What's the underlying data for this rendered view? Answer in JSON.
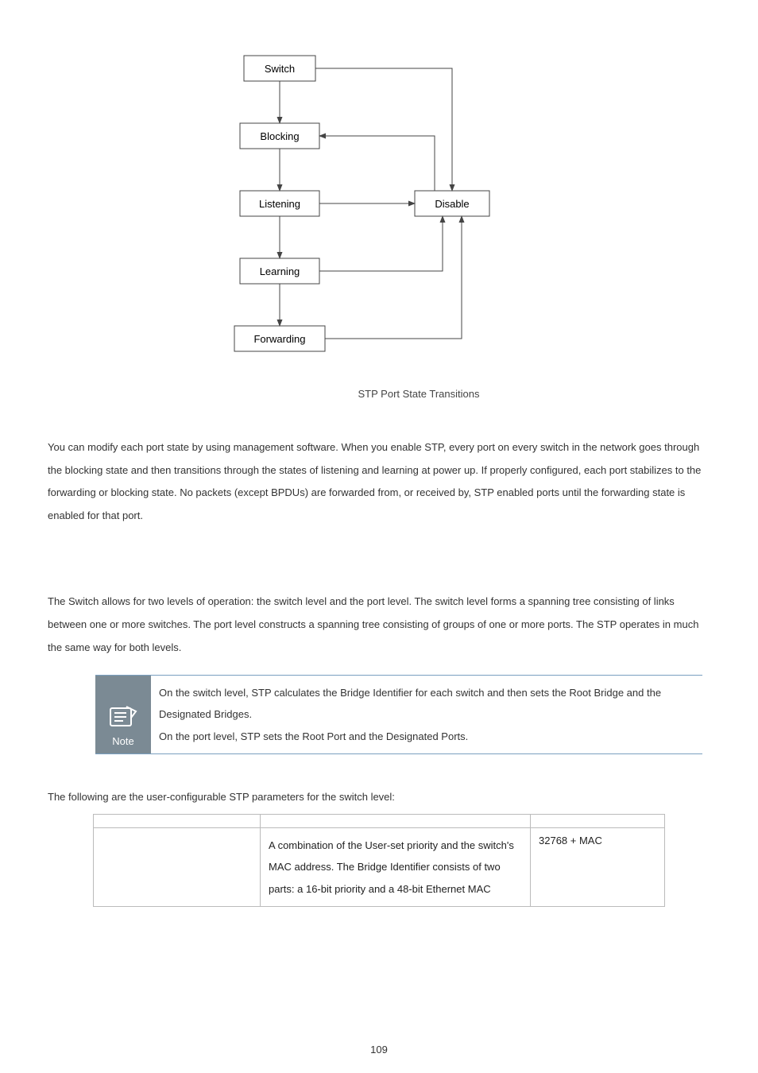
{
  "diagram": {
    "nodes": {
      "switch": "Switch",
      "blocking": "Blocking",
      "listening": "Listening",
      "learning": "Learning",
      "forwarding": "Forwarding",
      "disable": "Disable"
    },
    "caption": "STP Port State Transitions"
  },
  "paragraph1": "You can modify each port state by using management software. When you enable STP, every port on every switch in the network goes through the blocking state and then transitions through the states of listening and learning at power up. If properly configured, each port stabilizes to the forwarding or blocking state. No packets (except BPDUs) are forwarded from, or received by, STP enabled ports until the forwarding state is enabled for that port.",
  "paragraph2": "The Switch allows for two levels of operation: the switch level and the port level. The switch level forms a spanning tree consisting of links between one or more switches. The port level constructs a spanning tree consisting of groups of one or more ports. The STP operates in much the same way for both levels.",
  "note": {
    "badge": "Note",
    "line1": "On the switch level, STP calculates the Bridge Identifier for each switch and then sets the Root Bridge and the Designated Bridges.",
    "line2": "On the port level, STP sets the Root Port and the Designated Ports."
  },
  "paragraph3": "The following are the user-configurable STP parameters for the switch level:",
  "table": {
    "headers": {
      "c1": "",
      "c2": "",
      "c3": ""
    },
    "row1": {
      "param": "",
      "desc": "A combination of the User-set priority and the switch's MAC address.\nThe Bridge Identifier consists of two parts: a 16-bit priority and a 48-bit Ethernet MAC",
      "default": "32768 + MAC"
    }
  },
  "pageNumber": "109"
}
